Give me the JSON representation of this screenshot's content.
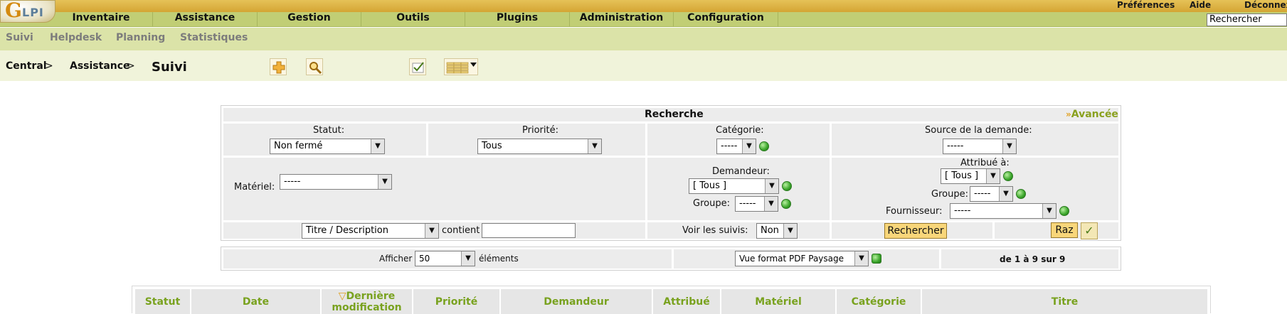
{
  "app": {
    "logo_text": "LPI",
    "logo_letter": "G"
  },
  "toplinks": {
    "preferences": "Préférences",
    "help": "Aide",
    "logout": "Déconnexion"
  },
  "mainmenu": [
    "Inventaire",
    "Assistance",
    "Gestion",
    "Outils",
    "Plugins",
    "Administration",
    "Configuration"
  ],
  "search": {
    "value": "Rechercher"
  },
  "submenu": [
    "Suivi",
    "Helpdesk",
    "Planning",
    "Statistiques"
  ],
  "breadcrumb": {
    "root": "Central",
    "section": "Assistance",
    "sep": ">",
    "title": "Suivi"
  },
  "toolbar_icons": [
    "add-icon",
    "search-icon",
    "checklist-icon",
    "column-list-icon"
  ],
  "panel": {
    "title": "Recherche",
    "advanced": "Avancée",
    "statut": {
      "label": "Statut:",
      "value": "Non fermé"
    },
    "priorite": {
      "label": "Priorité:",
      "value": "Tous"
    },
    "categorie": {
      "label": "Catégorie:",
      "value": "-----"
    },
    "source": {
      "label": "Source de la demande:",
      "value": "-----"
    },
    "materiel": {
      "label": "Matériel:",
      "value": "-----"
    },
    "demandeur": {
      "label": "Demandeur:",
      "value": "[ Tous ]"
    },
    "demandeur_groupe": {
      "label": "Groupe:",
      "value": "-----"
    },
    "attribue": {
      "label": "Attribué à:",
      "value": "[ Tous ]"
    },
    "attribue_groupe": {
      "label": "Groupe:",
      "value": "-----"
    },
    "fournisseur": {
      "label": "Fournisseur:",
      "value": "-----"
    },
    "field": {
      "value": "Titre / Description",
      "contains_label": "contient",
      "text": ""
    },
    "voir_suivis": {
      "label": "Voir les suivis:",
      "value": "Non"
    },
    "search_button": "Rechercher",
    "reset_button": "Raz"
  },
  "pager": {
    "show_label": "Afficher",
    "per_page": "50",
    "elements_label": "éléments",
    "export_format": "Vue format PDF Paysage",
    "range": "de 1 à 9 sur 9"
  },
  "table": {
    "sort_indicator": "▽",
    "columns": [
      "Statut",
      "Date",
      "Dernière modification",
      "Priorité",
      "Demandeur",
      "Attribué",
      "Matériel",
      "Catégorie",
      "Titre"
    ]
  },
  "colors": {
    "menu": "#c1ce75",
    "submenu": "#dbe3a8",
    "breadcrumb": "#f0f3da",
    "header_text": "#79a21f",
    "button": "#f8d67a"
  }
}
